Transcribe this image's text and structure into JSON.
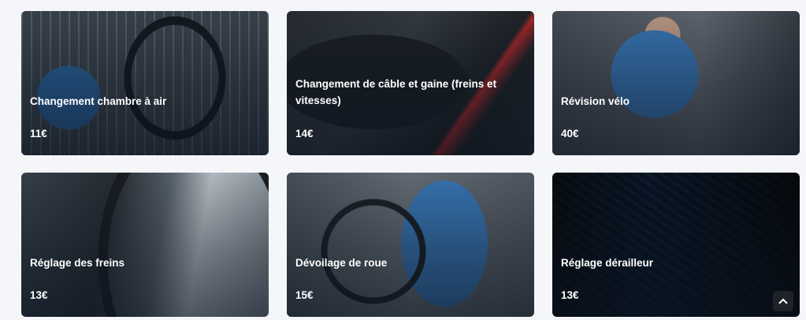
{
  "services": [
    {
      "title": "Changement chambre à air",
      "price": "11€",
      "image": "chambre-a-air-photo"
    },
    {
      "title": "Changement de câble et gaine (freins et vitesses)",
      "price": "14€",
      "image": "cable-gaine-photo"
    },
    {
      "title": "Révision vélo",
      "price": "40€",
      "image": "revision-photo"
    },
    {
      "title": "Réglage des freins",
      "price": "13€",
      "image": "freins-photo"
    },
    {
      "title": "Dévoilage de roue",
      "price": "15€",
      "image": "roue-photo"
    },
    {
      "title": "Réglage dérailleur",
      "price": "13€",
      "image": "derailleur-photo"
    }
  ],
  "scroll_top_icon": "chevron-up-icon"
}
